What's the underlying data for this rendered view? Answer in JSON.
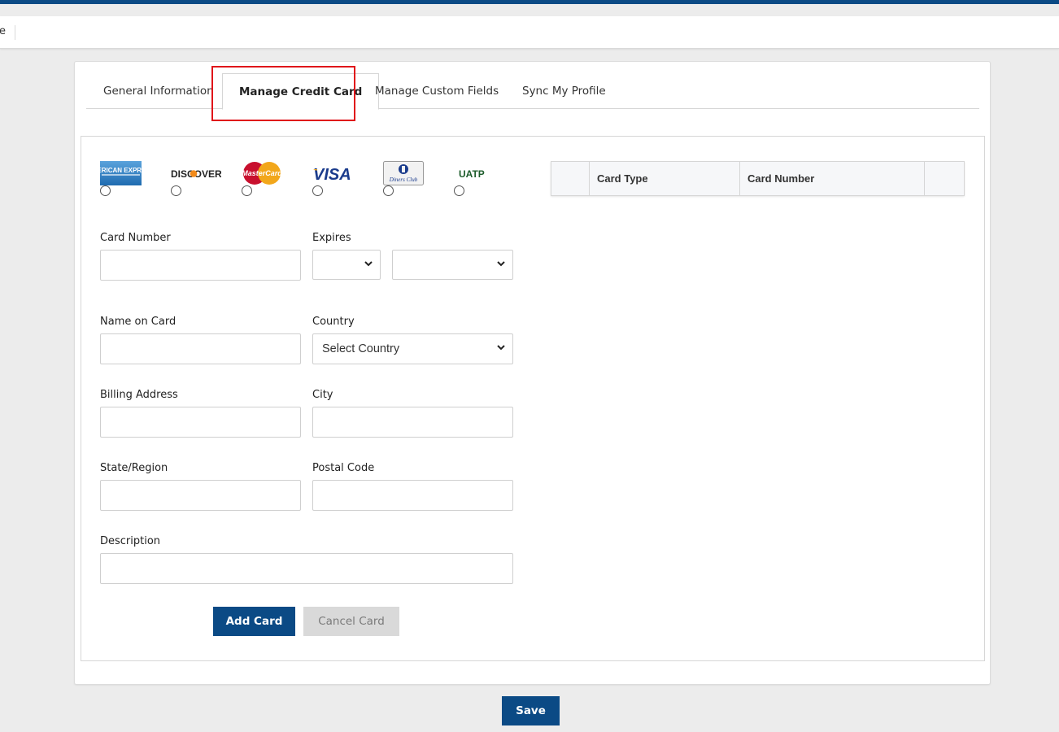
{
  "navbar": {
    "crumb_text": "e"
  },
  "tabs": [
    {
      "label": "General Information",
      "active": false
    },
    {
      "label": "Manage Credit Card",
      "active": true
    },
    {
      "label": "Manage Custom Fields",
      "active": false
    },
    {
      "label": "Sync My Profile",
      "active": false
    }
  ],
  "card_types": [
    {
      "name": "American Express",
      "logo_text": "AMERICAN EXPRESS",
      "icon": "amex-icon",
      "selected": false
    },
    {
      "name": "Discover",
      "logo_text": "DISCOVER",
      "icon": "discover-icon",
      "selected": false
    },
    {
      "name": "MasterCard",
      "logo_text": "MasterCard",
      "icon": "mastercard-icon",
      "selected": false
    },
    {
      "name": "Visa",
      "logo_text": "VISA",
      "icon": "visa-icon",
      "selected": false
    },
    {
      "name": "Diners Club",
      "logo_text": "Diners Club",
      "icon": "diners-club-icon",
      "selected": false
    },
    {
      "name": "UATP",
      "logo_text": "UATP",
      "icon": "uatp-icon",
      "selected": false
    }
  ],
  "form": {
    "card_number_label": "Card Number",
    "card_number_value": "",
    "expires_label": "Expires",
    "expires_month_value": "",
    "expires_year_value": "",
    "name_on_card_label": "Name on Card",
    "name_on_card_value": "",
    "country_label": "Country",
    "country_value": "Select Country",
    "billing_address_label": "Billing Address",
    "billing_address_value": "",
    "city_label": "City",
    "city_value": "",
    "state_region_label": "State/Region",
    "state_region_value": "",
    "postal_code_label": "Postal Code",
    "postal_code_value": "",
    "description_label": "Description",
    "description_value": ""
  },
  "buttons": {
    "add_card": "Add Card",
    "cancel_card": "Cancel Card",
    "save": "Save"
  },
  "cards_table": {
    "columns": [
      "",
      "Card Type",
      "Card Number",
      ""
    ],
    "rows": []
  },
  "colors": {
    "brand_blue": "#0b4a85",
    "highlight_red": "#e0131a",
    "disabled_gray": "#d9d9d9"
  }
}
